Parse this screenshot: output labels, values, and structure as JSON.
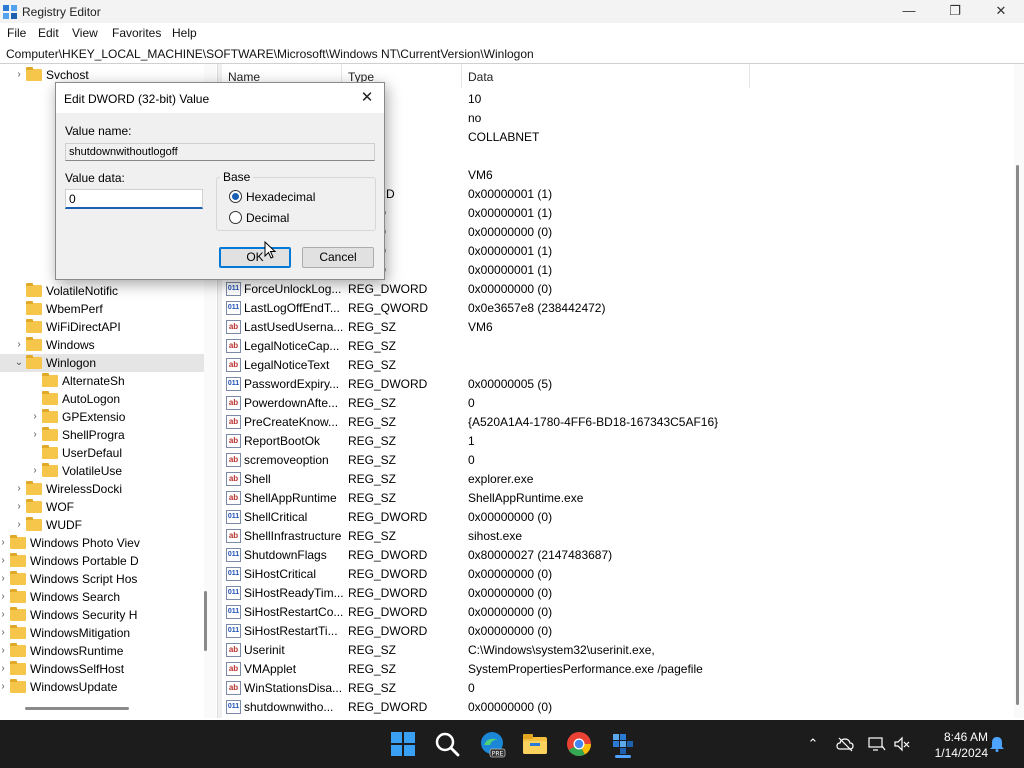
{
  "window": {
    "title": "Registry Editor",
    "minimize": "—",
    "maximize": "❐",
    "close": "✕"
  },
  "menu": [
    "File",
    "Edit",
    "View",
    "Favorites",
    "Help"
  ],
  "address": "Computer\\HKEY_LOCAL_MACHINE\\SOFTWARE\\Microsoft\\Windows NT\\CurrentVersion\\Winlogon",
  "tree": [
    {
      "label": "Svchost",
      "chev": "›"
    },
    {
      "label": "VolatileNotific",
      "chev": ""
    },
    {
      "label": "WbemPerf",
      "chev": ""
    },
    {
      "label": "WiFiDirectAPI",
      "chev": ""
    },
    {
      "label": "Windows",
      "chev": "›"
    },
    {
      "label": "Winlogon",
      "chev": "⌄"
    },
    {
      "label": "AlternateSh",
      "chev": ""
    },
    {
      "label": "AutoLogon",
      "chev": ""
    },
    {
      "label": "GPExtensio",
      "chev": "›"
    },
    {
      "label": "ShellProgra",
      "chev": "›"
    },
    {
      "label": "UserDefaul",
      "chev": ""
    },
    {
      "label": "VolatileUse",
      "chev": "›"
    },
    {
      "label": "WirelessDocki",
      "chev": "›"
    },
    {
      "label": "WOF",
      "chev": "›"
    },
    {
      "label": "WUDF",
      "chev": "›"
    },
    {
      "label": "Windows Photo Viev",
      "chev": "›"
    },
    {
      "label": "Windows Portable D",
      "chev": "›"
    },
    {
      "label": "Windows Script Hos",
      "chev": "›"
    },
    {
      "label": "Windows Search",
      "chev": "›"
    },
    {
      "label": "Windows Security H",
      "chev": "›"
    },
    {
      "label": "WindowsMitigation",
      "chev": "›"
    },
    {
      "label": "WindowsRuntime",
      "chev": "›"
    },
    {
      "label": "WindowsSelfHost",
      "chev": "›"
    },
    {
      "label": "WindowsUpdate",
      "chev": "›"
    }
  ],
  "columns": {
    "name": "Name",
    "type": "Type",
    "data": "Data"
  },
  "rows": [
    {
      "name": "",
      "type": "",
      "data": "10",
      "icon": ""
    },
    {
      "name": "",
      "type": "",
      "data": "no",
      "icon": ""
    },
    {
      "name": "",
      "type": "",
      "data": "COLLABNET",
      "icon": ""
    },
    {
      "name": "",
      "type": "",
      "data": "",
      "icon": ""
    },
    {
      "name": "",
      "type": "",
      "data": "VM6",
      "icon": ""
    },
    {
      "name": "",
      "type": "DWORD",
      "data": "0x00000001 (1)",
      "icon": ""
    },
    {
      "name": "",
      "type": "WORD",
      "data": "0x00000001 (1)",
      "icon": ""
    },
    {
      "name": "",
      "type": "WORD",
      "data": "0x00000000 (0)",
      "icon": ""
    },
    {
      "name": "",
      "type": "WORD",
      "data": "0x00000001 (1)",
      "icon": ""
    },
    {
      "name": "",
      "type": "WORD",
      "data": "0x00000001 (1)",
      "icon": ""
    },
    {
      "name": "ForceUnlockLog...",
      "type": "REG_DWORD",
      "data": "0x00000000 (0)",
      "icon": "bin"
    },
    {
      "name": "LastLogOffEndT...",
      "type": "REG_QWORD",
      "data": "0x0e3657e8 (238442472)",
      "icon": "bin"
    },
    {
      "name": "LastUsedUserna...",
      "type": "REG_SZ",
      "data": "VM6",
      "icon": "sz"
    },
    {
      "name": "LegalNoticeCap...",
      "type": "REG_SZ",
      "data": "",
      "icon": "sz"
    },
    {
      "name": "LegalNoticeText",
      "type": "REG_SZ",
      "data": "",
      "icon": "sz"
    },
    {
      "name": "PasswordExpiry...",
      "type": "REG_DWORD",
      "data": "0x00000005 (5)",
      "icon": "bin"
    },
    {
      "name": "PowerdownAfte...",
      "type": "REG_SZ",
      "data": "0",
      "icon": "sz"
    },
    {
      "name": "PreCreateKnow...",
      "type": "REG_SZ",
      "data": "{A520A1A4-1780-4FF6-BD18-167343C5AF16}",
      "icon": "sz"
    },
    {
      "name": "ReportBootOk",
      "type": "REG_SZ",
      "data": "1",
      "icon": "sz"
    },
    {
      "name": "scremoveoption",
      "type": "REG_SZ",
      "data": "0",
      "icon": "sz"
    },
    {
      "name": "Shell",
      "type": "REG_SZ",
      "data": "explorer.exe",
      "icon": "sz"
    },
    {
      "name": "ShellAppRuntime",
      "type": "REG_SZ",
      "data": "ShellAppRuntime.exe",
      "icon": "sz"
    },
    {
      "name": "ShellCritical",
      "type": "REG_DWORD",
      "data": "0x00000000 (0)",
      "icon": "bin"
    },
    {
      "name": "ShellInfrastructure",
      "type": "REG_SZ",
      "data": "sihost.exe",
      "icon": "sz"
    },
    {
      "name": "ShutdownFlags",
      "type": "REG_DWORD",
      "data": "0x80000027 (2147483687)",
      "icon": "bin"
    },
    {
      "name": "SiHostCritical",
      "type": "REG_DWORD",
      "data": "0x00000000 (0)",
      "icon": "bin"
    },
    {
      "name": "SiHostReadyTim...",
      "type": "REG_DWORD",
      "data": "0x00000000 (0)",
      "icon": "bin"
    },
    {
      "name": "SiHostRestartCo...",
      "type": "REG_DWORD",
      "data": "0x00000000 (0)",
      "icon": "bin"
    },
    {
      "name": "SiHostRestartTi...",
      "type": "REG_DWORD",
      "data": "0x00000000 (0)",
      "icon": "bin"
    },
    {
      "name": "Userinit",
      "type": "REG_SZ",
      "data": "C:\\Windows\\system32\\userinit.exe,",
      "icon": "sz"
    },
    {
      "name": "VMApplet",
      "type": "REG_SZ",
      "data": "SystemPropertiesPerformance.exe /pagefile",
      "icon": "sz"
    },
    {
      "name": "WinStationsDisa...",
      "type": "REG_SZ",
      "data": "0",
      "icon": "sz"
    },
    {
      "name": "shutdownwitho...",
      "type": "REG_DWORD",
      "data": "0x00000000 (0)",
      "icon": "bin"
    }
  ],
  "icon_text": {
    "bin": "011",
    "sz": "ab"
  },
  "dialog": {
    "title": "Edit DWORD (32-bit) Value",
    "close": "✕",
    "value_name_label": "Value name:",
    "value_name": "shutdownwithoutlogoff",
    "value_data_label": "Value data:",
    "value_data": "0",
    "base_label": "Base",
    "hex_label": "Hexadecimal",
    "dec_label": "Decimal",
    "ok": "OK",
    "cancel": "Cancel"
  },
  "tray": {
    "time": "8:46 AM",
    "date": "1/14/2024",
    "chevron": "⌃"
  },
  "colors": {
    "accent": "#0078d7",
    "taskbar": "#1c1c1c",
    "folder": "#f6c64a"
  }
}
